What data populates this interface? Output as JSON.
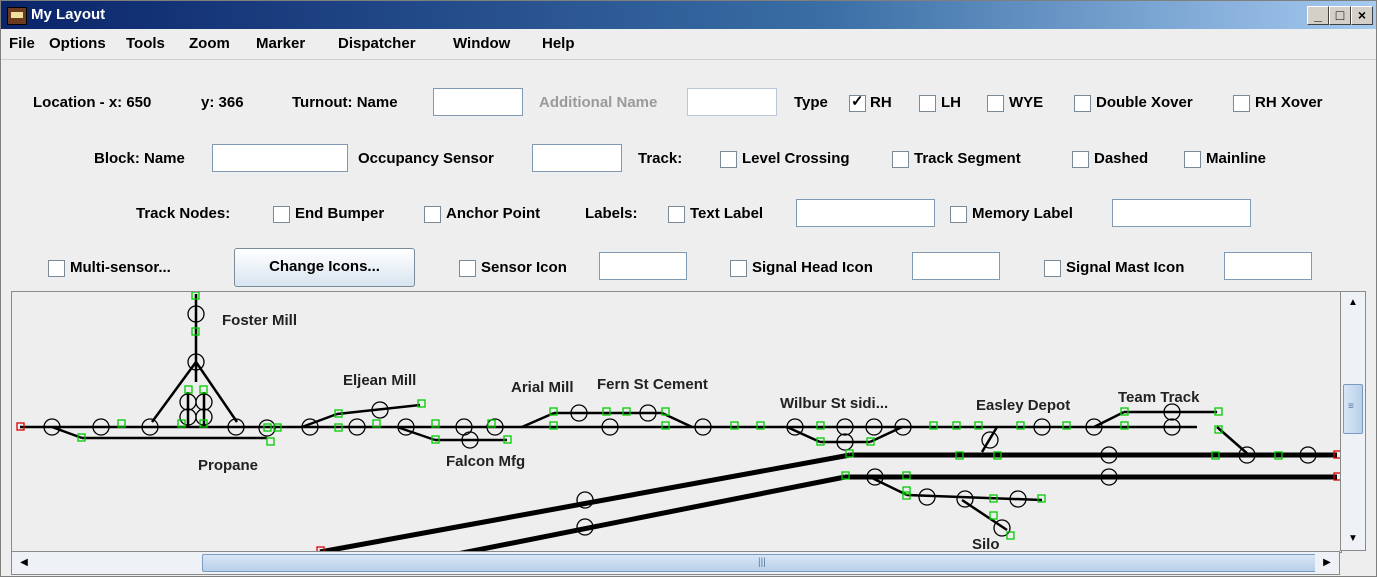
{
  "window": {
    "title": "My Layout"
  },
  "menu": [
    "File",
    "Options",
    "Tools",
    "Zoom",
    "Marker",
    "Dispatcher",
    "Window",
    "Help"
  ],
  "toolbar": {
    "location_label": "Location - x: 650",
    "y_label": "y: 366",
    "turnout_label": "Turnout: Name",
    "additional_name": "Additional Name",
    "type_label": "Type",
    "type_options": [
      "RH",
      "LH",
      "WYE",
      "Double Xover",
      "RH Xover"
    ],
    "block_name": "Block: Name",
    "occupancy_sensor": "Occupancy Sensor",
    "track_label": "Track:",
    "track_options": [
      "Level Crossing",
      "Track Segment",
      "Dashed",
      "Mainline"
    ],
    "track_nodes_label": "Track Nodes:",
    "end_bumper": "End Bumper",
    "anchor_point": "Anchor Point",
    "labels_label": "Labels:",
    "text_label": "Text Label",
    "memory_label": "Memory Label",
    "multi_sensor": "Multi-sensor...",
    "change_icons": "Change Icons...",
    "sensor_icon": "Sensor Icon",
    "signal_head_icon": "Signal Head Icon",
    "signal_mast_icon": "Signal Mast Icon"
  },
  "canvas_labels": [
    "Foster Mill",
    "Eljean Mill",
    "Arial Mill",
    "Fern St Cement",
    "Wilbur St sidi...",
    "Easley Depot",
    "Team Track",
    "Propane",
    "Falcon Mfg",
    "Silo"
  ],
  "colors": {
    "track": "#000000",
    "anchor": "#00cc00",
    "end_bumper": "#dd0000",
    "title_start": "#0a246a"
  }
}
